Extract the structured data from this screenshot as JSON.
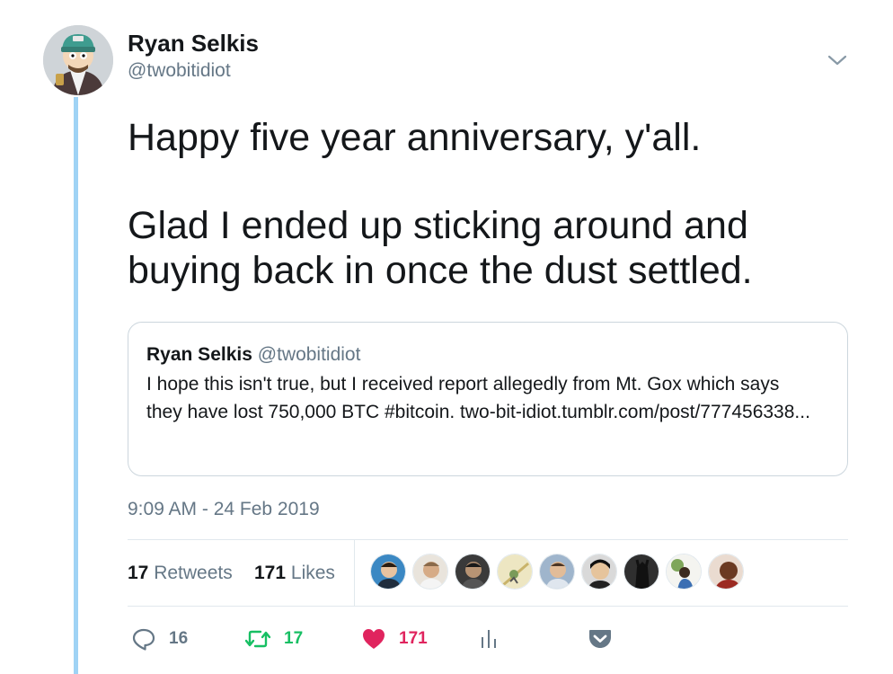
{
  "tweet": {
    "author_name": "Ryan Selkis",
    "author_handle": "@twobitidiot",
    "avatar_icon": "cartoon-avatar",
    "menu_icon": "chevron-down-icon",
    "text_paragraphs": [
      "Happy five year anniversary, y'all.",
      "Glad I ended up sticking around and buying back in once the dust settled."
    ],
    "timestamp": "9:09 AM - 24 Feb 2019"
  },
  "quoted_tweet": {
    "author_name": "Ryan Selkis",
    "author_handle": "@twobitidiot",
    "text": "I hope this isn't true, but I received report allegedly from Mt. Gox which says they have lost 750,000 BTC #bitcoin. two-bit-idiot.tumblr.com/post/777456338..."
  },
  "stats": {
    "retweets_count": "17",
    "retweets_label": "Retweets",
    "likes_count": "171",
    "likes_label": "Likes"
  },
  "likers": [
    {
      "name": "liker-1",
      "color": "#3b88c3"
    },
    {
      "name": "liker-2",
      "color": "#c9a27e"
    },
    {
      "name": "liker-3",
      "color": "#4a4a4a"
    },
    {
      "name": "liker-4",
      "color": "#d8cfa0"
    },
    {
      "name": "liker-5",
      "color": "#8aa7c2"
    },
    {
      "name": "liker-6",
      "color": "#2b2b2b"
    },
    {
      "name": "liker-7",
      "color": "#333333"
    },
    {
      "name": "liker-8",
      "color": "#6a8f5a"
    },
    {
      "name": "liker-9",
      "color": "#8b3a2a"
    }
  ],
  "actions": {
    "reply_count": "16",
    "retweet_count": "17",
    "like_count": "171",
    "icons": [
      "reply-icon",
      "retweet-icon",
      "heart-icon",
      "analytics-icon",
      "pocket-icon"
    ]
  },
  "colors": {
    "thread_line": "#9fd3f5",
    "secondary_text": "#657786",
    "retweet_green": "#17bf63",
    "like_red": "#e0245e",
    "pocket_gray": "#657786"
  }
}
